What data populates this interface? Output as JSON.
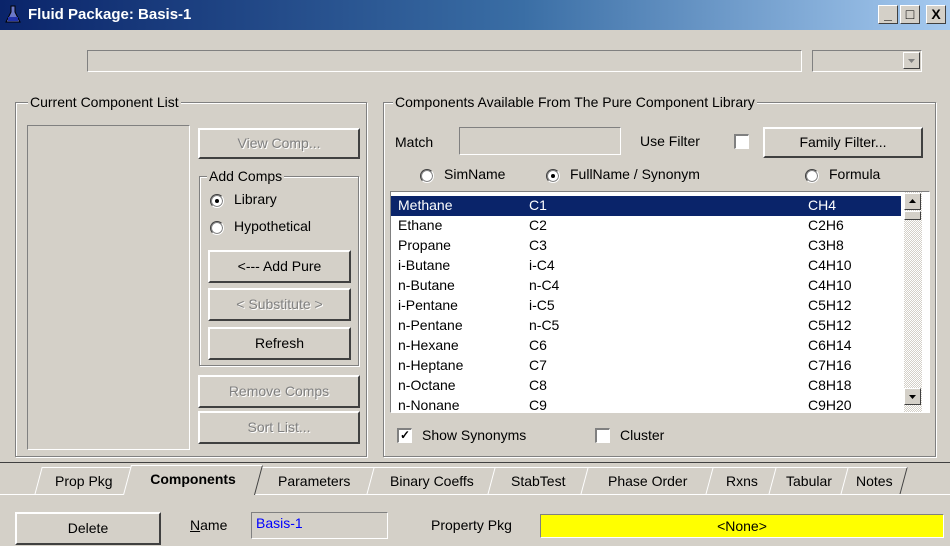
{
  "window": {
    "title": "Fluid Package: Basis-1",
    "min": "_",
    "max": "□",
    "close": "X"
  },
  "current_list": {
    "label": "Current Component List"
  },
  "buttons": {
    "view_comp": "View Comp...",
    "add_pure": "<--- Add Pure",
    "substitute": "< Substitute >",
    "refresh": "Refresh",
    "remove_comps": "Remove Comps",
    "sort_list": "Sort List...",
    "family_filter": "Family Filter...",
    "delete": "Delete"
  },
  "add_comps": {
    "label": "Add Comps",
    "library": "Library",
    "hypothetical": "Hypothetical",
    "selected": "library"
  },
  "library": {
    "label": "Components Available From The Pure Component Library",
    "match_label": "Match",
    "match_value": "",
    "use_filter_label": "Use Filter",
    "use_filter_checked": false,
    "radio_simname": "SimName",
    "radio_fullname": "FullName / Synonym",
    "radio_formula": "Formula",
    "radio_selected": "fullname",
    "rows": [
      {
        "name": "Methane",
        "sim": "C1",
        "formula": "CH4"
      },
      {
        "name": "Ethane",
        "sim": "C2",
        "formula": "C2H6"
      },
      {
        "name": "Propane",
        "sim": "C3",
        "formula": "C3H8"
      },
      {
        "name": "i-Butane",
        "sim": "i-C4",
        "formula": "C4H10"
      },
      {
        "name": "n-Butane",
        "sim": "n-C4",
        "formula": "C4H10"
      },
      {
        "name": "i-Pentane",
        "sim": "i-C5",
        "formula": "C5H12"
      },
      {
        "name": "n-Pentane",
        "sim": "n-C5",
        "formula": "C5H12"
      },
      {
        "name": "n-Hexane",
        "sim": "C6",
        "formula": "C6H14"
      },
      {
        "name": "n-Heptane",
        "sim": "C7",
        "formula": "C7H16"
      },
      {
        "name": "n-Octane",
        "sim": "C8",
        "formula": "C8H18"
      },
      {
        "name": "n-Nonane",
        "sim": "C9",
        "formula": "C9H20"
      }
    ],
    "selected_index": 0,
    "show_synonyms_label": "Show Synonyms",
    "show_synonyms_checked": true,
    "cluster_label": "Cluster",
    "cluster_checked": false
  },
  "tabs": [
    "Prop Pkg",
    "Components",
    "Parameters",
    "Binary Coeffs",
    "StabTest",
    "Phase Order",
    "Rxns",
    "Tabular",
    "Notes"
  ],
  "active_tab": "Components",
  "footer": {
    "name_label": "Name",
    "name_value": "Basis-1",
    "prop_pkg_label": "Property Pkg",
    "prop_pkg_value": "<None>"
  },
  "colors": {
    "title_bar": "#0a246a",
    "selection": "#0a246a",
    "prop_pkg_field": "#ffff00",
    "name_text": "#0000ff"
  }
}
